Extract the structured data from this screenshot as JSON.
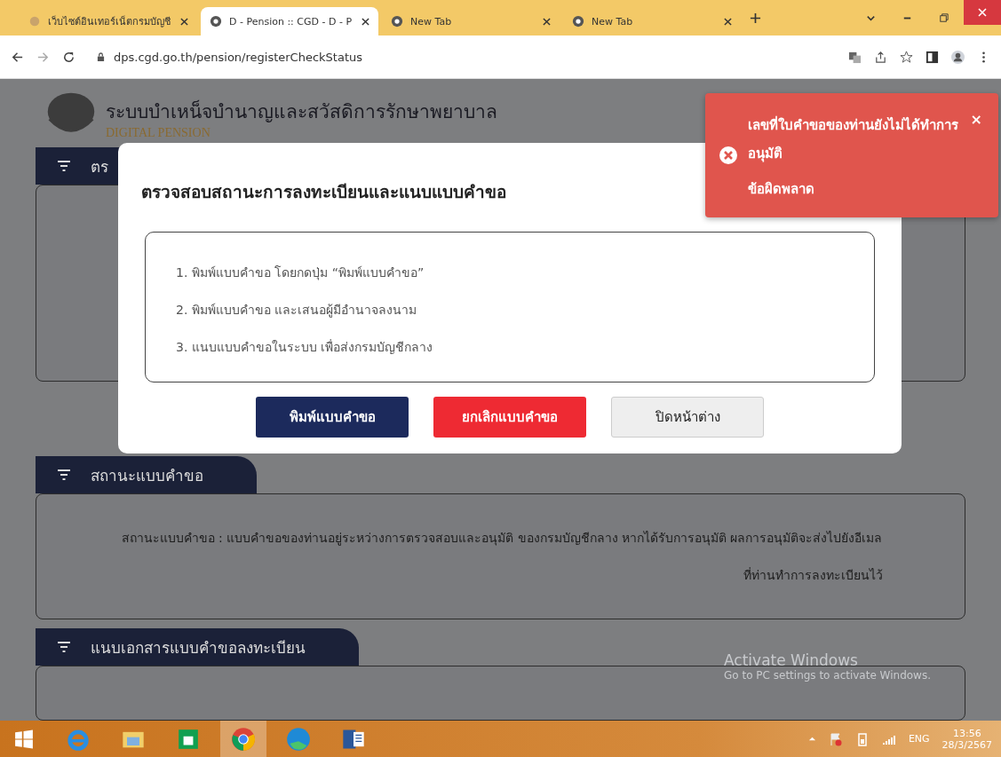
{
  "browser": {
    "tabs": [
      {
        "title": "เว็บไซต์อินเทอร์เน็ตกรมบัญชี",
        "kind": "site",
        "selected": false
      },
      {
        "title": "D - Pension :: CGD - D - P",
        "kind": "chrome",
        "selected": true
      },
      {
        "title": "New Tab",
        "kind": "chrome",
        "selected": false
      },
      {
        "title": "New Tab",
        "kind": "chrome",
        "selected": false
      }
    ],
    "url": "dps.cgd.go.th/pension/registerCheckStatus"
  },
  "page": {
    "site_title": "ระบบบำเหน็จบำนาญและสวัสดิการรักษาพยาบาล",
    "site_subtitle": "DIGITAL PENSION",
    "sections": [
      {
        "title": "ตร"
      },
      {
        "title": "สถานะแบบคำขอ",
        "text": "สถานะแบบคำขอ : แบบคำขอของท่านอยู่ระหว่างการตรวจสอบและอนุมัติ ของกรมบัญชีกลาง หากได้รับการอนุมัติ ผลการอนุมัติจะส่งไปยังอีเมล ที่ท่านทำการลงทะเบียนไว้"
      },
      {
        "title": "แนบเอกสารแบบคำขอลงทะเบียน"
      }
    ]
  },
  "modal": {
    "title": "ตรวจสอบสถานะการลงทะเบียนและแนบแบบคำขอ",
    "steps": [
      "1. พิมพ์แบบคำขอ โดยกดปุ่ม “พิมพ์แบบคำขอ”",
      "2. พิมพ์แบบคำขอ และเสนอผู้มีอำนาจลงนาม",
      "3. แนบแบบคำขอในระบบ เพื่อส่งกรมบัญชีกลาง"
    ],
    "buttons": [
      {
        "label": "พิมพ์แบบคำขอ",
        "kind": "primary"
      },
      {
        "label": "ยกเลิกแบบคำขอ",
        "kind": "danger"
      },
      {
        "label": "ปิดหน้าต่าง",
        "kind": "default"
      }
    ]
  },
  "toast": {
    "message": "เลขที่ใบคำขอของท่านยังไม่ได้ทำการอนุมัติ",
    "title": "ข้อผิดพลาด",
    "close": "×"
  },
  "os_notice": {
    "title": "Activate Windows",
    "subtitle": "Go to PC settings to activate Windows."
  },
  "taskbar": {
    "apps": [
      {
        "kind": "ie",
        "selected": false
      },
      {
        "kind": "explorer",
        "selected": false
      },
      {
        "kind": "store",
        "selected": false
      },
      {
        "kind": "chrome",
        "selected": true
      },
      {
        "kind": "edge",
        "selected": false
      },
      {
        "kind": "word",
        "selected": false
      }
    ],
    "language": "ENG",
    "time": "13:56",
    "date": "28/3/2567"
  }
}
